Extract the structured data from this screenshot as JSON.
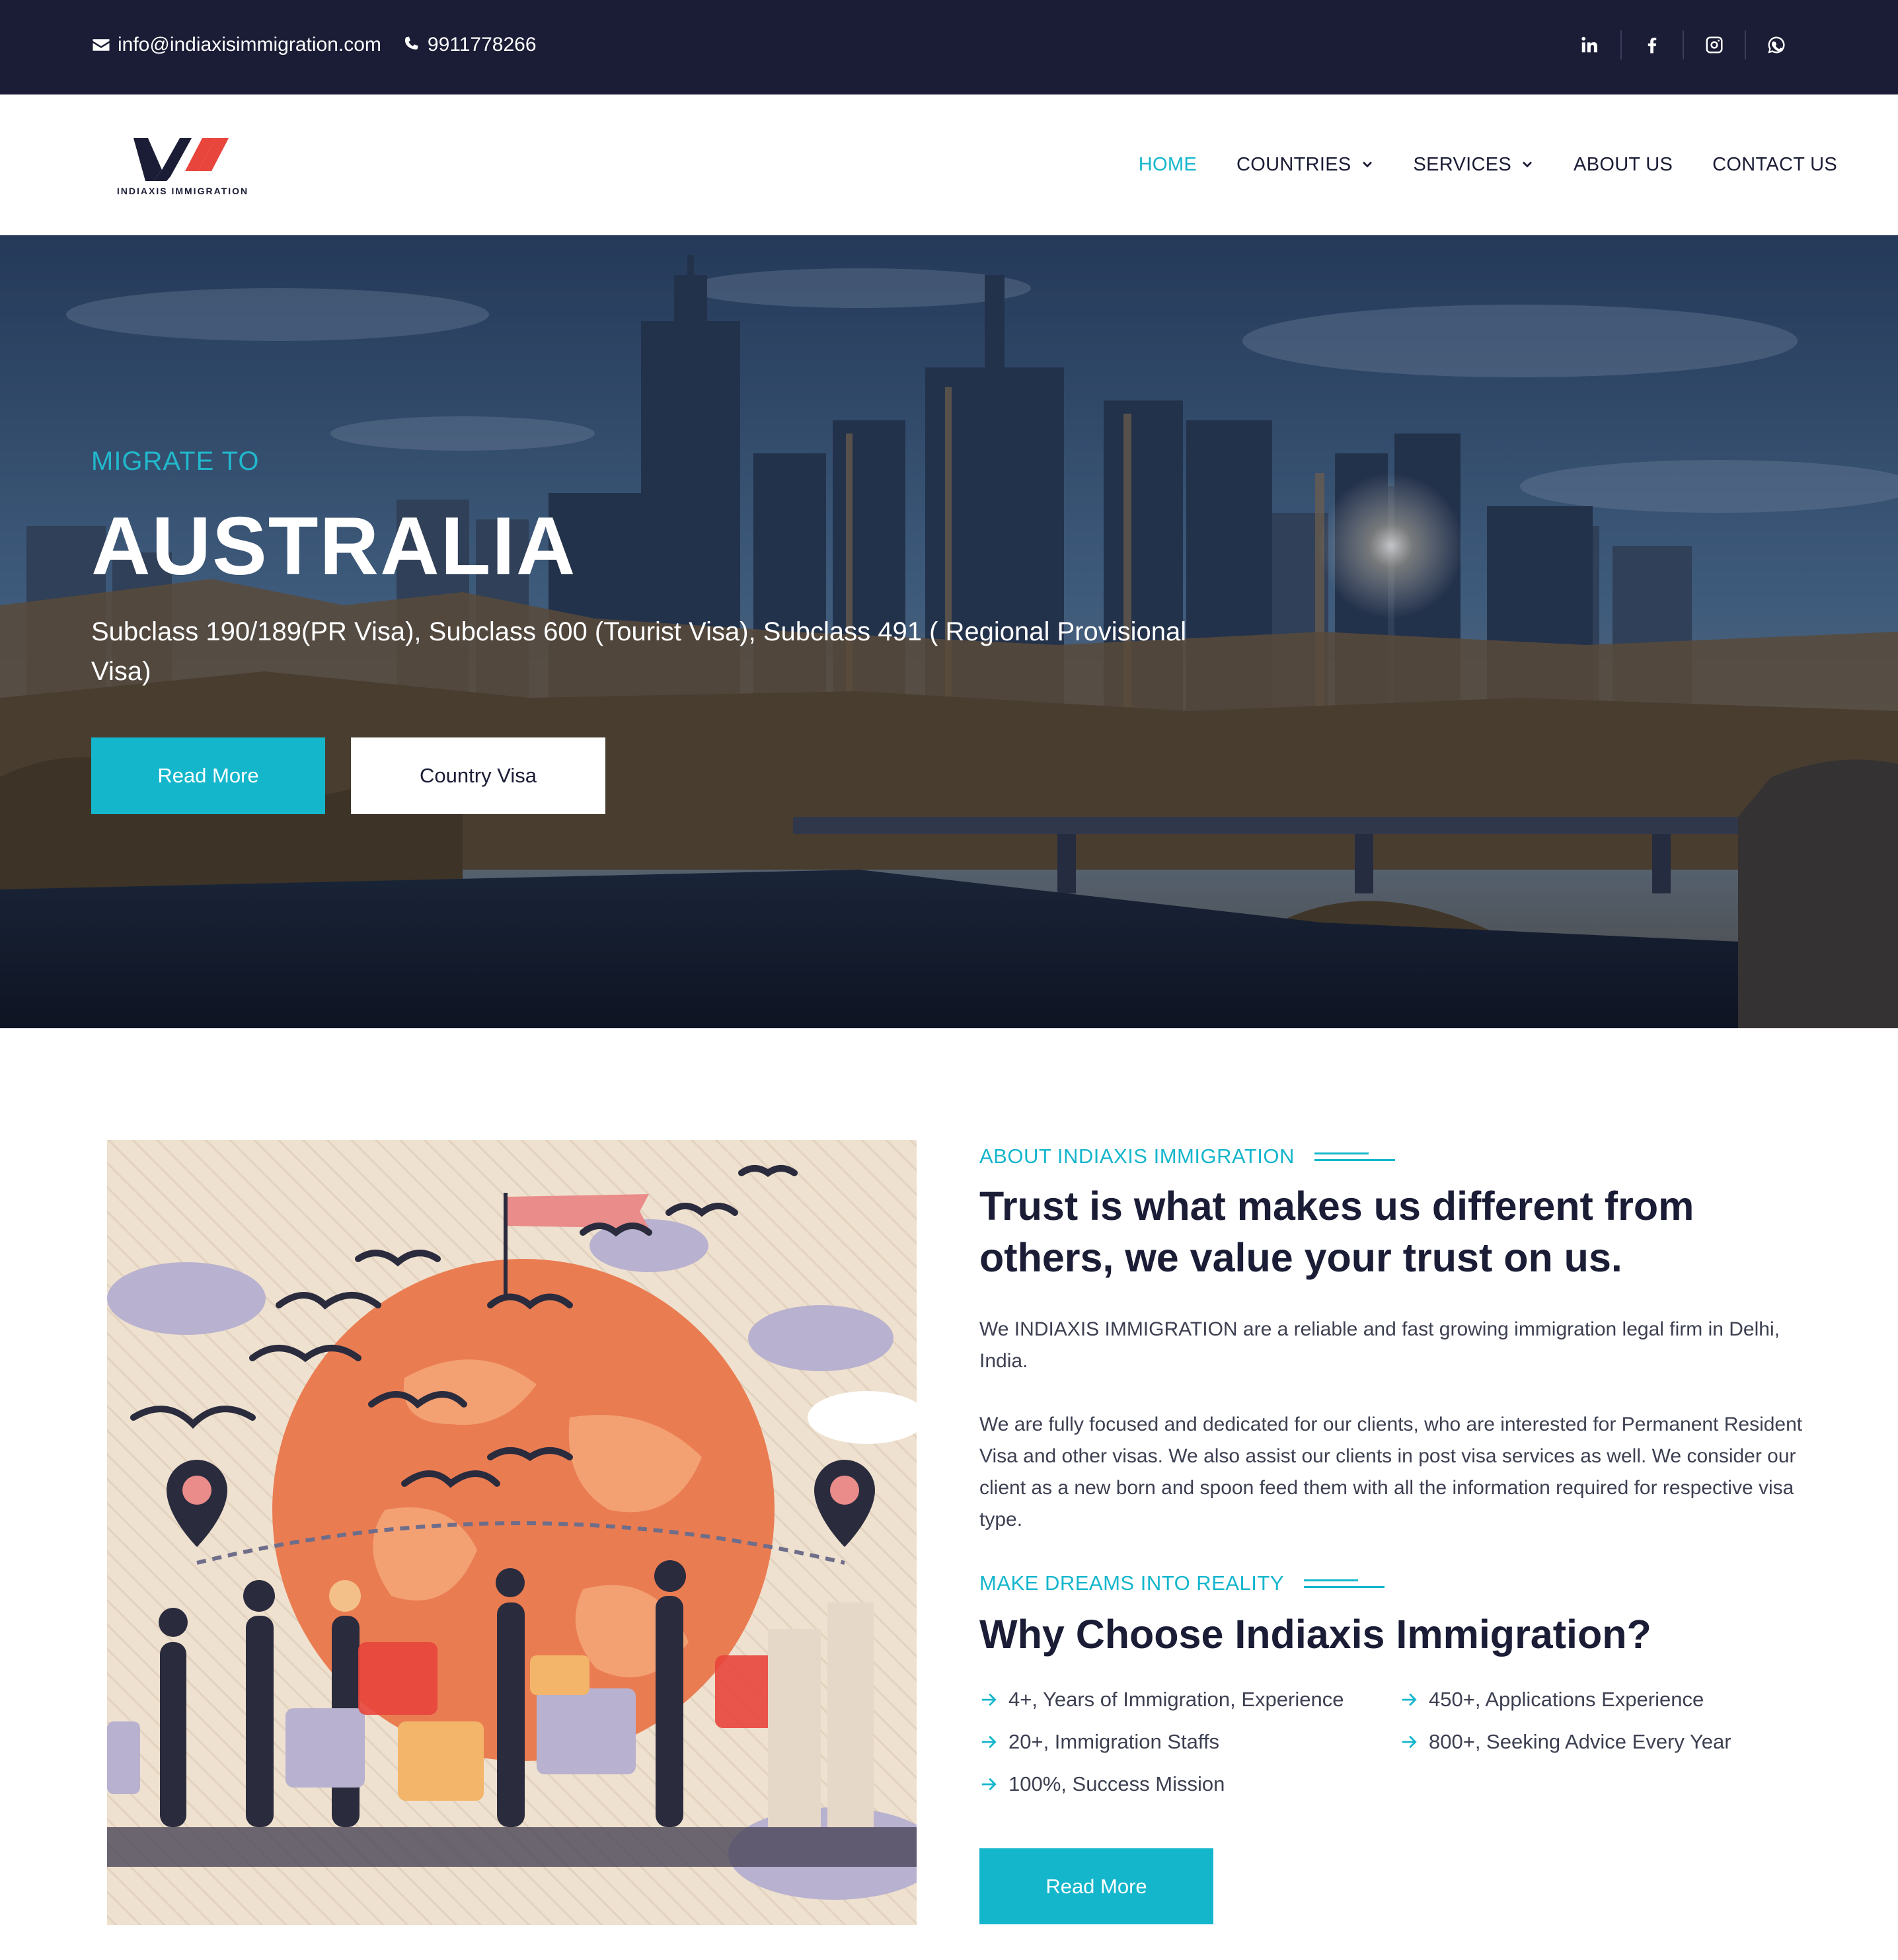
{
  "topbar": {
    "email": "info@indiaxisimmigration.com",
    "phone": "9911778266",
    "social": [
      "linkedin-icon",
      "facebook-icon",
      "instagram-icon",
      "whatsapp-icon"
    ]
  },
  "brand": {
    "name": "INDIAXIS IMMIGRATION",
    "colors": {
      "navy": "#1b1d36",
      "accent": "#14b6cc",
      "logo_red": "#e8453c"
    }
  },
  "nav": {
    "items": [
      {
        "label": "HOME",
        "active": true
      },
      {
        "label": "COUNTRIES",
        "dropdown": true
      },
      {
        "label": "SERVICES",
        "dropdown": true
      },
      {
        "label": "ABOUT US"
      },
      {
        "label": "CONTACT US"
      }
    ]
  },
  "hero": {
    "pretitle": "MIGRATE TO",
    "title": "AUSTRALIA",
    "subtitle": "Subclass 190/189(PR Visa), Subclass 600 (Tourist Visa), Subclass 491 ( Regional Provisional Visa)",
    "primary_button": "Read More",
    "secondary_button": "Country Visa"
  },
  "about": {
    "eyebrow": "ABOUT INDIAXIS IMMIGRATION",
    "heading": "Trust is what makes us different from others, we value your trust on us.",
    "para1": "We INDIAXIS IMMIGRATION are a reliable and fast growing immigration legal firm in Delhi, India.",
    "para2": "We are fully focused and dedicated for our clients, who are interested for Permanent Resident Visa and other visas. We also assist our clients in post visa services as well. We consider our client as a new born and spoon feed them with all the information required for respective visa type."
  },
  "why": {
    "eyebrow": "MAKE DREAMS INTO REALITY",
    "heading": "Why Choose Indiaxis Immigration?",
    "features": [
      "4+, Years of Immigration, Experience",
      "450+, Applications Experience",
      "20+, Immigration Staffs",
      "800+, Seeking Advice Every Year",
      "100%, Success Mission"
    ],
    "button": "Read More"
  }
}
